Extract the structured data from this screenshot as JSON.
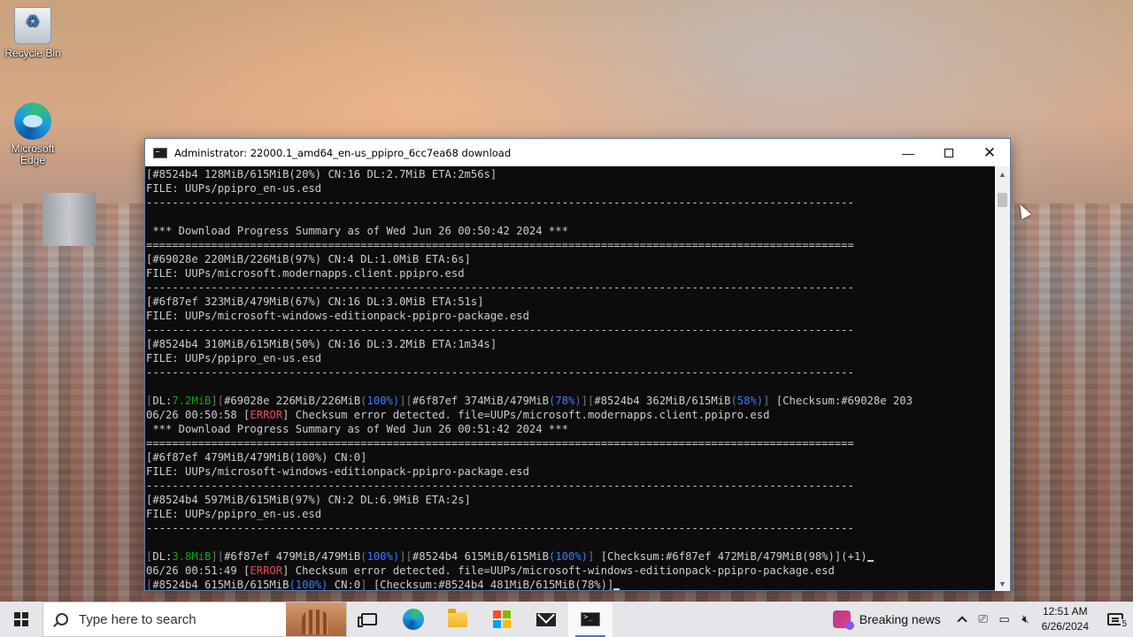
{
  "desktop": {
    "icons": [
      {
        "label": "Recycle Bin",
        "icon": "recycle-bin-icon"
      },
      {
        "label": "Microsoft Edge",
        "icon": "edge-icon"
      }
    ]
  },
  "window": {
    "title": "Administrator:  22000.1_amd64_en-us_ppipro_6cc7ea68 download",
    "buttons": {
      "minimize": "—",
      "maximize": "",
      "close": "✕"
    }
  },
  "terminal": {
    "lines": [
      [
        {
          "t": "[#8524b4 128MiB/615MiB(20%) CN:16 DL:2.7MiB ETA:2m56s]"
        }
      ],
      [
        {
          "t": "FILE: UUPs/ppipro_en-us.esd"
        }
      ],
      [
        {
          "t": "-------------------------------------------------------------------------------------------------------------"
        }
      ],
      [
        {
          "t": ""
        }
      ],
      [
        {
          "t": " *** Download Progress Summary as of Wed Jun 26 00:50:42 2024 ***"
        }
      ],
      [
        {
          "t": "============================================================================================================="
        }
      ],
      [
        {
          "t": "[#69028e 220MiB/226MiB(97%) CN:4 DL:1.0MiB ETA:6s]"
        }
      ],
      [
        {
          "t": "FILE: UUPs/microsoft.modernapps.client.ppipro.esd"
        }
      ],
      [
        {
          "t": "-------------------------------------------------------------------------------------------------------------"
        }
      ],
      [
        {
          "t": "[#6f87ef 323MiB/479MiB(67%) CN:16 DL:3.0MiB ETA:51s]"
        }
      ],
      [
        {
          "t": "FILE: UUPs/microsoft-windows-editionpack-ppipro-package.esd"
        }
      ],
      [
        {
          "t": "-------------------------------------------------------------------------------------------------------------"
        }
      ],
      [
        {
          "t": "[#8524b4 310MiB/615MiB(50%) CN:16 DL:3.2MiB ETA:1m34s]"
        }
      ],
      [
        {
          "t": "FILE: UUPs/ppipro_en-us.esd"
        }
      ],
      [
        {
          "t": "-------------------------------------------------------------------------------------------------------------"
        }
      ],
      [
        {
          "t": ""
        }
      ],
      [
        {
          "t": "[",
          "c": "dim"
        },
        {
          "t": "DL:"
        },
        {
          "t": "7.2MiB",
          "c": "green"
        },
        {
          "t": "][",
          "c": "dim"
        },
        {
          "t": "#69028e 226MiB/226MiB"
        },
        {
          "t": "(100%)",
          "c": "blue"
        },
        {
          "t": "][",
          "c": "dim"
        },
        {
          "t": "#6f87ef 374MiB/479MiB"
        },
        {
          "t": "(78%)",
          "c": "blue"
        },
        {
          "t": "][",
          "c": "dim"
        },
        {
          "t": "#8524b4 362MiB/615MiB"
        },
        {
          "t": "(58%)",
          "c": "blue"
        },
        {
          "t": "]",
          "c": "dim"
        },
        {
          "t": " [Checksum:#69028e 203"
        }
      ],
      [
        {
          "t": "06/26 00:50:58 ["
        },
        {
          "t": "ERROR",
          "c": "red"
        },
        {
          "t": "] Checksum error detected. file=UUPs/microsoft.modernapps.client.ppipro.esd"
        }
      ],
      [
        {
          "t": " *** Download Progress Summary as of Wed Jun 26 00:51:42 2024 ***"
        }
      ],
      [
        {
          "t": "============================================================================================================="
        }
      ],
      [
        {
          "t": "[#6f87ef 479MiB/479MiB(100%) CN:0]"
        }
      ],
      [
        {
          "t": "FILE: UUPs/microsoft-windows-editionpack-ppipro-package.esd"
        }
      ],
      [
        {
          "t": "-------------------------------------------------------------------------------------------------------------"
        }
      ],
      [
        {
          "t": "[#8524b4 597MiB/615MiB(97%) CN:2 DL:6.9MiB ETA:2s]"
        }
      ],
      [
        {
          "t": "FILE: UUPs/ppipro_en-us.esd"
        }
      ],
      [
        {
          "t": "-------------------------------------------------------------------------------------------------------------"
        }
      ],
      [
        {
          "t": ""
        }
      ],
      [
        {
          "t": "[",
          "c": "dim"
        },
        {
          "t": "DL:"
        },
        {
          "t": "3.8MiB",
          "c": "green"
        },
        {
          "t": "][",
          "c": "dim"
        },
        {
          "t": "#6f87ef 479MiB/479MiB"
        },
        {
          "t": "(100%)",
          "c": "blue"
        },
        {
          "t": "][",
          "c": "dim"
        },
        {
          "t": "#8524b4 615MiB/615MiB"
        },
        {
          "t": "(100%)",
          "c": "blue"
        },
        {
          "t": "]",
          "c": "dim"
        },
        {
          "t": " [Checksum:#6f87ef 472MiB/479MiB(98%)](+1)"
        },
        {
          "cursor": true
        }
      ],
      [
        {
          "t": "06/26 00:51:49 ["
        },
        {
          "t": "ERROR",
          "c": "red"
        },
        {
          "t": "] Checksum error detected. file=UUPs/microsoft-windows-editionpack-ppipro-package.esd"
        }
      ],
      [
        {
          "t": "[",
          "c": "dim"
        },
        {
          "t": "#8524b4 615MiB/615MiB"
        },
        {
          "t": "(100%)",
          "c": "blue"
        },
        {
          "t": " CN:0"
        },
        {
          "t": "]",
          "c": "dim"
        },
        {
          "t": " [Checksum:#8524b4 481MiB/615MiB(78%)]"
        },
        {
          "cursor": true
        }
      ]
    ]
  },
  "taskbar": {
    "search_placeholder": "Type here to search",
    "apps": [
      {
        "name": "task-view",
        "icon": "task-view-icon"
      },
      {
        "name": "edge",
        "icon": "edge-icon"
      },
      {
        "name": "file-explorer",
        "icon": "folder-icon"
      },
      {
        "name": "store",
        "icon": "store-icon"
      },
      {
        "name": "mail",
        "icon": "mail-icon"
      },
      {
        "name": "command-prompt",
        "icon": "cmd-icon",
        "active": true
      }
    ],
    "news_label": "Breaking news",
    "time": "12:51 AM",
    "date": "6/26/2024",
    "notification_count": "5"
  },
  "colors": {
    "terminal_bg": "#0c0c0c",
    "terminal_fg": "#cccccc",
    "green": "#13a10e",
    "red": "#e74856",
    "blue": "#3b78ff"
  }
}
